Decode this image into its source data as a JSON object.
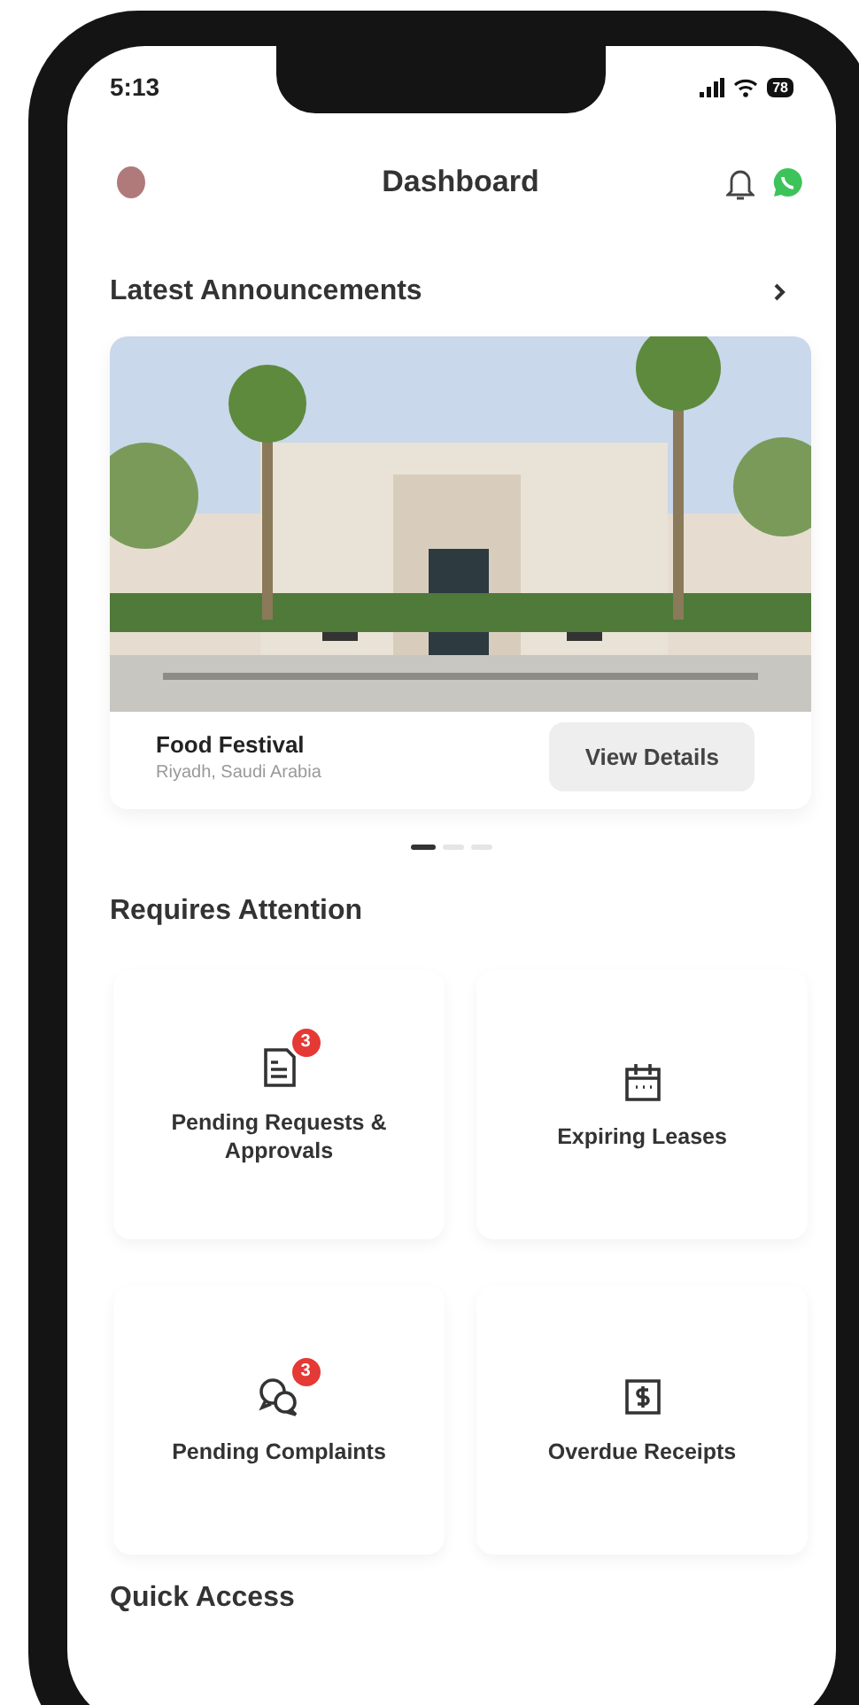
{
  "status_bar": {
    "time": "5:13",
    "battery": "78"
  },
  "header": {
    "title": "Dashboard"
  },
  "announcements": {
    "title": "Latest Announcements",
    "slides": [
      {
        "kind": "picture",
        "title": "Food Festival",
        "location": "Riyadh, Saudi Arabia",
        "button": "View Details"
      }
    ],
    "dots": [
      {
        "selected": true
      },
      {
        "selected": false
      },
      {
        "selected": false
      }
    ]
  },
  "attention": {
    "title": "Requires Attention",
    "items": [
      {
        "kind": "document",
        "label": "Pending Requests & Approvals",
        "badge": "3"
      },
      {
        "kind": "calendar",
        "label": "Expiring Leases"
      },
      {
        "kind": "chat",
        "label": "Pending Complaints",
        "badge": "3"
      },
      {
        "kind": "receipt",
        "label": "Overdue Receipts"
      }
    ]
  },
  "quick_access": {
    "title": "Quick Access"
  }
}
